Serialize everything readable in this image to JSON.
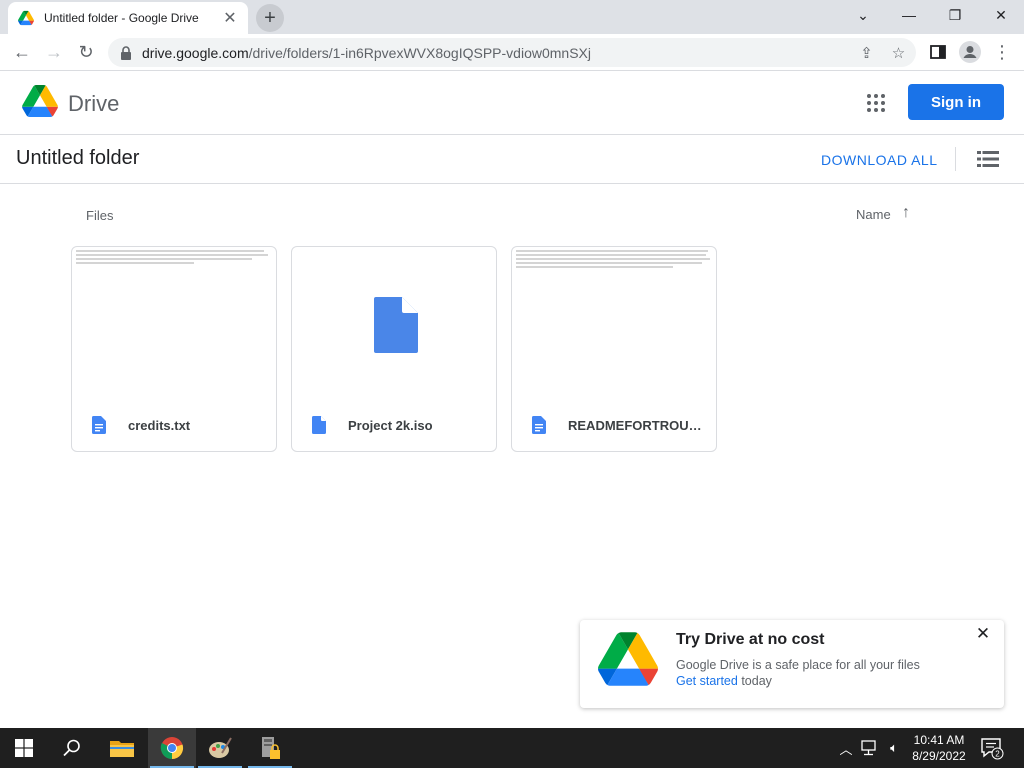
{
  "browser": {
    "tab_title": "Untitled folder - Google Drive",
    "url_host": "drive.google.com",
    "url_path": "/drive/folders/1-in6RpvexWVX8ogIQSPP-vdiow0mnSXj"
  },
  "header": {
    "product_name": "Drive",
    "sign_in_label": "Sign in"
  },
  "folder": {
    "title": "Untitled folder",
    "download_all_label": "DOWNLOAD ALL"
  },
  "files_section": {
    "label": "Files",
    "sort_label": "Name",
    "sort_direction": "ascending",
    "items": [
      {
        "name": "credits.txt",
        "icon": "doc-icon",
        "thumbnail": "text-preview"
      },
      {
        "name": "Project 2k.iso",
        "icon": "doc-icon",
        "thumbnail": "generic-file"
      },
      {
        "name": "READMEFORTROUBL...",
        "icon": "doc-icon",
        "thumbnail": "text-preview"
      }
    ]
  },
  "promo": {
    "title": "Try Drive at no cost",
    "line1": "Google Drive is a safe place for all your files",
    "link_text": "Get started",
    "line2_suffix": " today"
  },
  "taskbar": {
    "time": "10:41 AM",
    "date": "8/29/2022",
    "notification_count": "2"
  },
  "colors": {
    "accent": "#1a73e8",
    "taskbar": "#1f1f1f",
    "tabstrip": "#dee1e6"
  }
}
